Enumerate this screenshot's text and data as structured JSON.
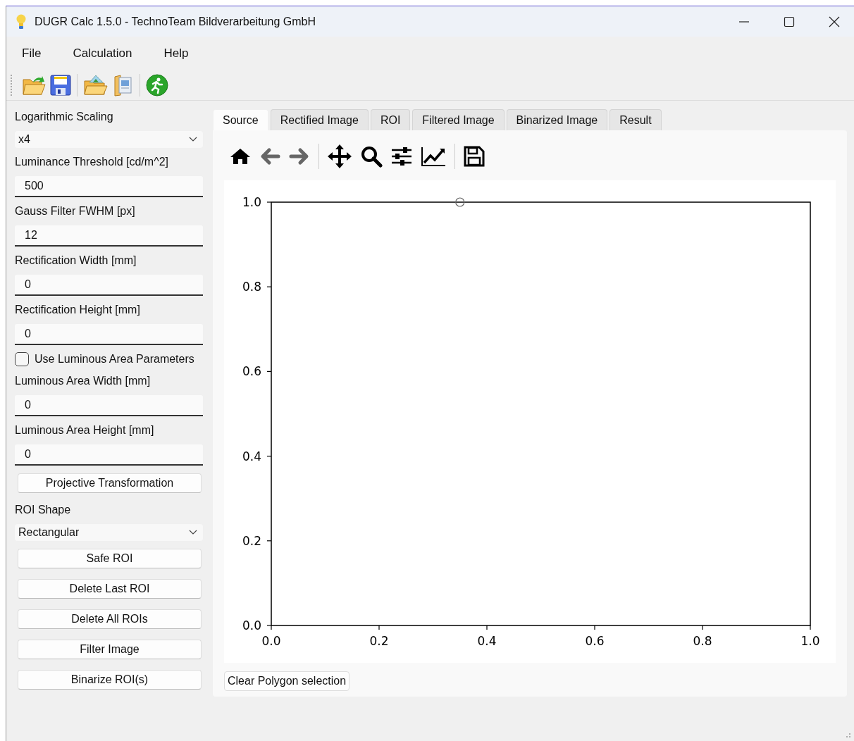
{
  "window": {
    "title": "DUGR Calc 1.5.0 - TechnoTeam Bildverarbeitung GmbH"
  },
  "menu": [
    "File",
    "Calculation",
    "Help"
  ],
  "toolbar": [
    {
      "kind": "open-file"
    },
    {
      "kind": "save"
    },
    {
      "kind": "separator"
    },
    {
      "kind": "open-image"
    },
    {
      "kind": "documents"
    },
    {
      "kind": "separator"
    },
    {
      "kind": "run"
    }
  ],
  "controls": [
    {
      "kind": "label",
      "text": "Logarithmic Scaling"
    },
    {
      "kind": "select",
      "value": "x4"
    },
    {
      "kind": "label",
      "text": "Luminance Threshold [cd/m^2]"
    },
    {
      "kind": "input",
      "value": "500"
    },
    {
      "kind": "label",
      "text": "Gauss Filter FWHM [px]"
    },
    {
      "kind": "input",
      "value": "12"
    },
    {
      "kind": "label",
      "text": "Rectification Width [mm]"
    },
    {
      "kind": "input",
      "value": "0"
    },
    {
      "kind": "label",
      "text": "Rectification Height [mm]"
    },
    {
      "kind": "input",
      "value": "0"
    },
    {
      "kind": "checkbox",
      "text": "Use Luminous Area Parameters",
      "checked": false
    },
    {
      "kind": "label",
      "text": "Luminous Area Width [mm]"
    },
    {
      "kind": "input",
      "value": "0"
    },
    {
      "kind": "label",
      "text": "Luminous Area Height [mm]"
    },
    {
      "kind": "input",
      "value": "0"
    },
    {
      "kind": "button",
      "text": "Projective Transformation"
    },
    {
      "kind": "label",
      "text": "ROI Shape"
    },
    {
      "kind": "select",
      "value": "Rectangular"
    },
    {
      "kind": "button",
      "text": "Safe ROI"
    },
    {
      "kind": "button",
      "text": "Delete Last ROI"
    },
    {
      "kind": "button",
      "text": "Delete All ROIs"
    },
    {
      "kind": "button",
      "text": "Filter Image"
    },
    {
      "kind": "button",
      "text": "Binarize ROI(s)"
    }
  ],
  "tabs": [
    {
      "label": "Source",
      "selected": true
    },
    {
      "label": "Rectified Image",
      "selected": false
    },
    {
      "label": "ROI",
      "selected": false
    },
    {
      "label": "Filtered Image",
      "selected": false
    },
    {
      "label": "Binarized Image",
      "selected": false
    },
    {
      "label": "Result",
      "selected": false
    }
  ],
  "plot_toolbar": [
    {
      "kind": "home"
    },
    {
      "kind": "back"
    },
    {
      "kind": "forward"
    },
    {
      "kind": "separator"
    },
    {
      "kind": "pan"
    },
    {
      "kind": "zoom"
    },
    {
      "kind": "configure"
    },
    {
      "kind": "edit-axes"
    },
    {
      "kind": "separator"
    },
    {
      "kind": "save"
    }
  ],
  "chart_data": {
    "type": "scatter",
    "x": [
      0.35
    ],
    "series": [
      {
        "values": [
          1.0
        ]
      }
    ],
    "xlim": [
      0,
      1
    ],
    "ylim": [
      0,
      1
    ],
    "xticks": [
      {
        "value": 0,
        "label": "0.0"
      },
      {
        "value": 0.2,
        "label": "0.2"
      },
      {
        "value": 0.4,
        "label": "0.4"
      },
      {
        "value": 0.6,
        "label": "0.6"
      },
      {
        "value": 0.8,
        "label": "0.8"
      },
      {
        "value": 1,
        "label": "1.0"
      }
    ],
    "yticks": [
      {
        "value": 0,
        "label": "0.0"
      },
      {
        "value": 0.2,
        "label": "0.2"
      },
      {
        "value": 0.4,
        "label": "0.4"
      },
      {
        "value": 0.6,
        "label": "0.6"
      },
      {
        "value": 0.8,
        "label": "0.8"
      },
      {
        "value": 1,
        "label": "1.0"
      }
    ]
  },
  "clear_button": "Clear Polygon selection"
}
